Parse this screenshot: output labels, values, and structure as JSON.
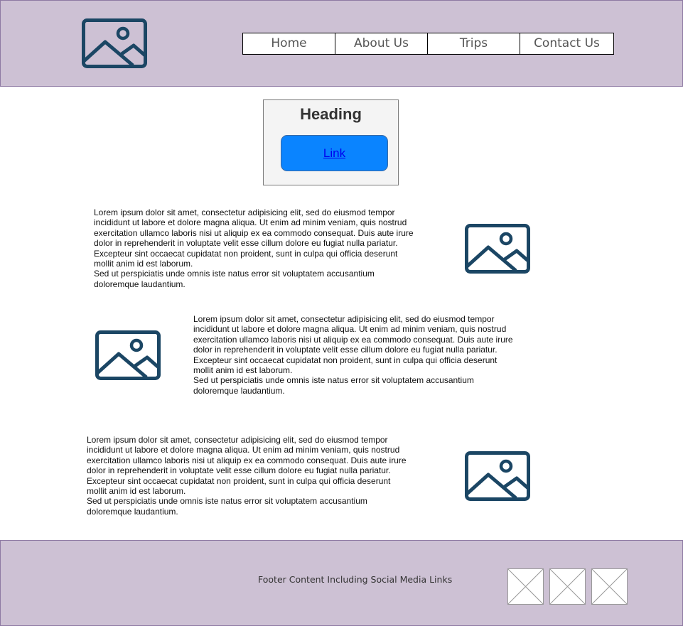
{
  "header": {
    "logo_icon": "image-placeholder-icon",
    "nav": [
      "Home",
      "About Us",
      "Trips",
      "Contact Us"
    ]
  },
  "hero": {
    "heading": "Heading",
    "link_label": "Link"
  },
  "sections": [
    {
      "paragraph": "Lorem ipsum dolor sit amet, consectetur adipisicing elit, sed do eiusmod tempor incididunt ut labore et dolore magna aliqua. Ut enim ad minim veniam, quis nostrud exercitation ullamco laboris nisi ut aliquip ex ea commodo consequat. Duis aute irure dolor in reprehenderit in voluptate velit esse cillum dolore eu fugiat nulla pariatur. Excepteur sint occaecat cupidatat non proident, sunt in culpa qui officia deserunt mollit anim id est laborum.",
      "paragraph_2": "Sed ut perspiciatis unde omnis iste natus error sit voluptatem accusantium doloremque laudantium.",
      "image_icon": "image-placeholder-icon"
    },
    {
      "paragraph": "Lorem ipsum dolor sit amet, consectetur adipisicing elit, sed do eiusmod tempor incididunt ut labore et dolore magna aliqua. Ut enim ad minim veniam, quis nostrud exercitation ullamco laboris nisi ut aliquip ex ea commodo consequat. Duis aute irure dolor in reprehenderit in voluptate velit esse cillum dolore eu fugiat nulla pariatur. Excepteur sint occaecat cupidatat non proident, sunt in culpa qui officia deserunt mollit anim id est laborum.",
      "paragraph_2": "Sed ut perspiciatis unde omnis iste natus error sit voluptatem accusantium doloremque laudantium.",
      "image_icon": "image-placeholder-icon"
    },
    {
      "paragraph": "Lorem ipsum dolor sit amet, consectetur adipisicing elit, sed do eiusmod tempor incididunt ut labore et dolore magna aliqua. Ut enim ad minim veniam, quis nostrud exercitation ullamco laboris nisi ut aliquip ex ea commodo consequat. Duis aute irure dolor in reprehenderit in voluptate velit esse cillum dolore eu fugiat nulla pariatur. Excepteur sint occaecat cupidatat non proident, sunt in culpa qui officia deserunt mollit anim id est laborum.",
      "paragraph_2": "Sed ut perspiciatis unde omnis iste natus error sit voluptatem accusantium doloremque laudantium.",
      "image_icon": "image-placeholder-icon"
    }
  ],
  "footer": {
    "text": "Footer Content Including Social Media Links",
    "social_icons": [
      "social-placeholder-icon",
      "social-placeholder-icon",
      "social-placeholder-icon"
    ]
  },
  "colors": {
    "header_bg": "#cdc1d4",
    "icon_stroke": "#1b4664",
    "link_button_bg": "#0a84ff"
  }
}
